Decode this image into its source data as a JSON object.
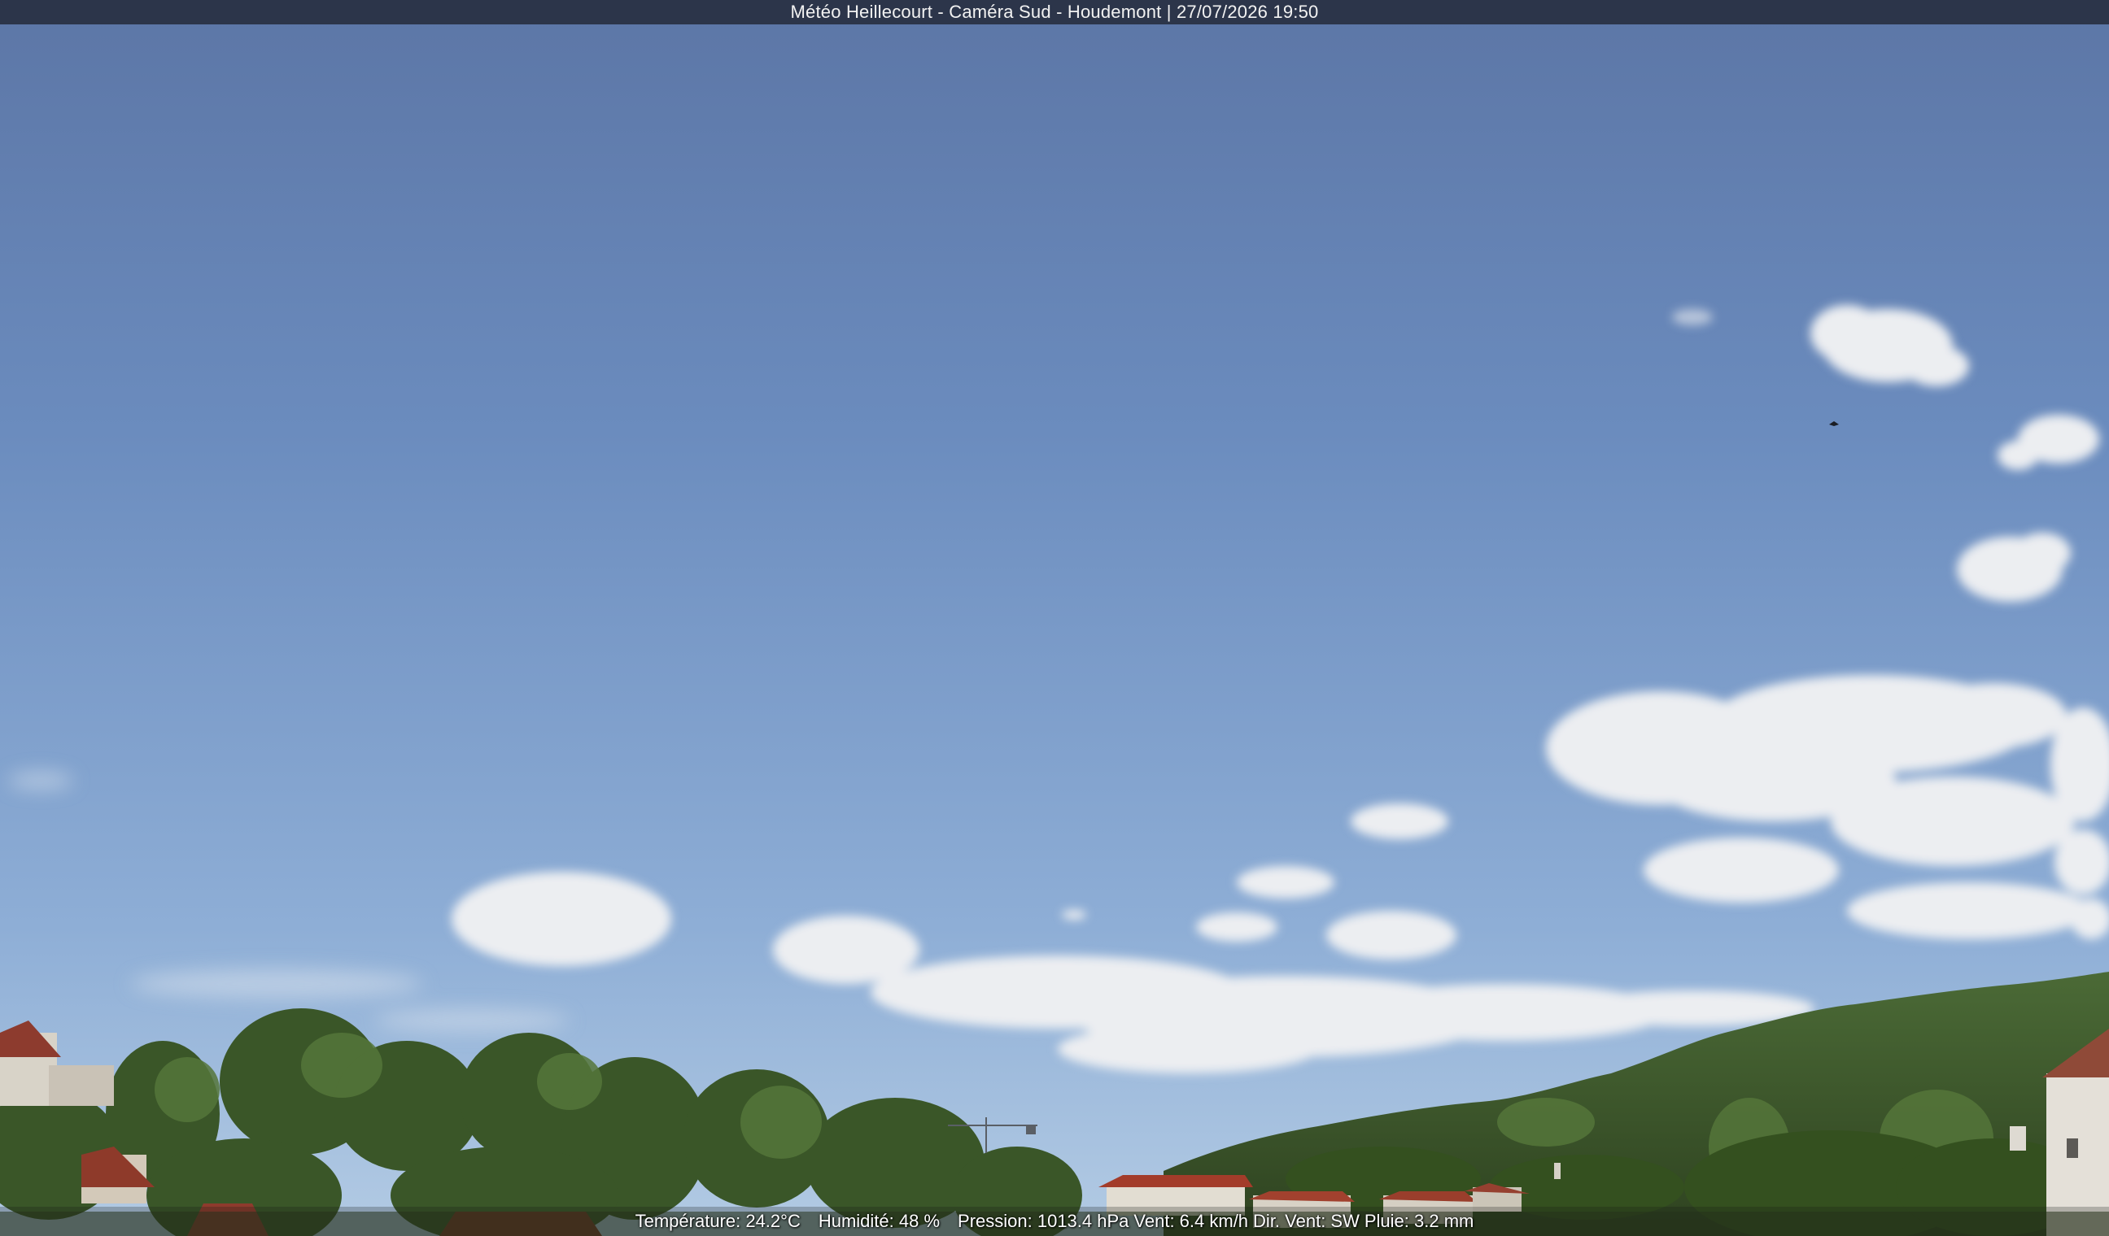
{
  "camera": {
    "title": "Météo Heillecourt - Caméra Sud - Houdemont | 27/07/2026 19:50"
  },
  "weather": {
    "temperature": "Température: 24.2°C",
    "humidity": "Humidité: 48 %",
    "pressure": "Pression: 1013.4 hPa",
    "wind": "Vent: 6.4 km/h",
    "wind_direction": "Dir. Vent: SW",
    "rain": "Pluie: 3.2 mm"
  },
  "colors": {
    "sky_top": "#5f7aa8",
    "sky_horizon": "#a9c3df",
    "cloud": "#eef0f2",
    "vegetation": "#3f5c2c",
    "roof": "#9a3d2c",
    "titlebar": "#283042"
  },
  "icons": {
    "bird": "bird-icon",
    "crane": "crane-icon"
  }
}
